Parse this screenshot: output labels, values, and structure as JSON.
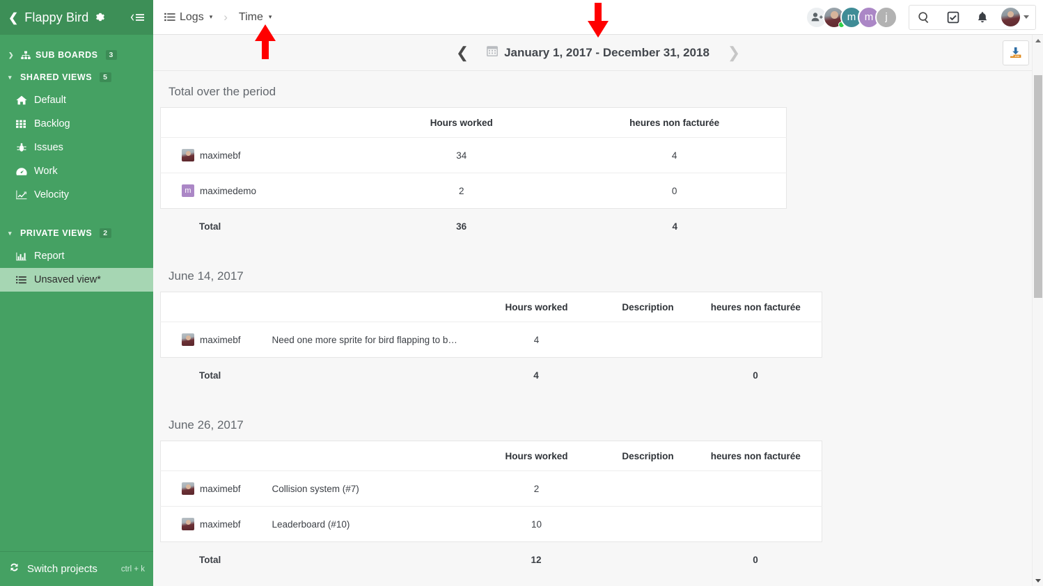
{
  "sidebar": {
    "back_icon": "chevron-left-icon",
    "project_title": "Flappy Bird",
    "gear_icon": "gear-icon",
    "collapse_icon": "collapse-sidebar-icon",
    "groups": [
      {
        "label": "SUB BOARDS",
        "count": "3",
        "icon": "sitemap-icon",
        "expanded": false
      },
      {
        "label": "SHARED VIEWS",
        "count": "5",
        "icon": "",
        "expanded": true
      },
      {
        "label": "PRIVATE VIEWS",
        "count": "2",
        "icon": "",
        "expanded": true
      }
    ],
    "shared_views": [
      {
        "label": "Default",
        "icon": "home-icon"
      },
      {
        "label": "Backlog",
        "icon": "grid-icon"
      },
      {
        "label": "Issues",
        "icon": "bug-icon"
      },
      {
        "label": "Work",
        "icon": "dashboard-icon"
      },
      {
        "label": "Velocity",
        "icon": "chart-line-icon"
      }
    ],
    "private_views": [
      {
        "label": "Report",
        "icon": "bar-chart-icon",
        "active": false
      },
      {
        "label": "Unsaved view*",
        "icon": "list-icon",
        "active": true
      }
    ],
    "footer": {
      "icon": "refresh-icon",
      "label": "Switch projects",
      "shortcut": "ctrl + k"
    }
  },
  "topbar": {
    "breadcrumb": [
      {
        "label": "Logs",
        "icon": "list-icon",
        "caret": "▾"
      },
      {
        "label": "Time",
        "icon": "",
        "caret": "▾"
      }
    ],
    "separator": "›",
    "avatars": [
      {
        "type": "add",
        "label": "",
        "icon": "add-user-icon"
      },
      {
        "type": "photo",
        "label": "",
        "online": true
      },
      {
        "type": "teal",
        "label": "m"
      },
      {
        "type": "purple",
        "label": "m"
      },
      {
        "type": "gray",
        "label": "j"
      }
    ],
    "tools": [
      {
        "name": "search-icon"
      },
      {
        "name": "tasks-checkbox-icon"
      },
      {
        "name": "bell-icon"
      }
    ],
    "profile_caret": "▾"
  },
  "datebar": {
    "prev_icon": "chevron-left-icon",
    "next_icon": "chevron-right-icon",
    "calendar_icon": "calendar-icon",
    "range": "January 1, 2017 - December 31, 2018",
    "download_icon": "download-icon"
  },
  "sections": [
    {
      "title": "Total over the period",
      "columns": [
        "",
        "Hours worked",
        "heures non facturée"
      ],
      "has_description": false,
      "rows": [
        {
          "user": "maximebf",
          "avatar": "photo",
          "description": "",
          "hours": "34",
          "non_billed": "4"
        },
        {
          "user": "maximedemo",
          "avatar": "purple",
          "initial": "m",
          "description": "",
          "hours": "2",
          "non_billed": "0"
        }
      ],
      "total_label": "Total",
      "total_hours": "36",
      "total_non_billed": "4"
    },
    {
      "title": "June 14, 2017",
      "columns": [
        "",
        "Hours worked",
        "Description",
        "heures non facturée"
      ],
      "has_description": true,
      "rows": [
        {
          "user": "maximebf",
          "avatar": "photo",
          "description": "Need one more sprite for bird flapping to b…",
          "hours": "4",
          "non_billed": ""
        }
      ],
      "total_label": "Total",
      "total_hours": "4",
      "total_non_billed": "0"
    },
    {
      "title": "June 26, 2017",
      "columns": [
        "",
        "Hours worked",
        "Description",
        "heures non facturée"
      ],
      "has_description": true,
      "rows": [
        {
          "user": "maximebf",
          "avatar": "photo",
          "description": "Collision system (#7)",
          "hours": "2",
          "non_billed": ""
        },
        {
          "user": "maximebf",
          "avatar": "photo",
          "description": "Leaderboard (#10)",
          "hours": "10",
          "non_billed": ""
        }
      ],
      "total_label": "Total",
      "total_hours": "12",
      "total_non_billed": "0"
    }
  ],
  "annotations": [
    {
      "name": "arrow-up-time",
      "direction": "up",
      "color": "#FF0000"
    },
    {
      "name": "arrow-down-daterange",
      "direction": "down",
      "color": "#FF0000"
    }
  ],
  "colors": {
    "sidebar_green": "#45a163",
    "sidebar_header_green": "#3d8f57",
    "active_item_green": "#a6d6b3",
    "annotation_red": "#FF0000"
  }
}
